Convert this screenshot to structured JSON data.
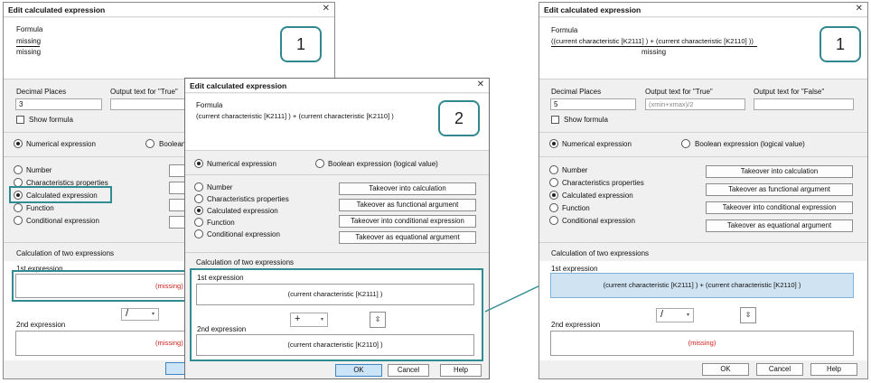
{
  "d1": {
    "title": "Edit calculated expression",
    "close": "✕",
    "callout": "1",
    "formula_label": "Formula",
    "formula_top": "missing",
    "formula_bottom": "missing",
    "decimal_label": "Decimal Places",
    "decimal_value": "3",
    "output_true_label": "Output text for \"True\"",
    "show_formula": "Show formula",
    "numerical": "Numerical expression",
    "boolean": "Boolean",
    "types": [
      "Number",
      "Characteristics properties",
      "Calculated expression",
      "Function",
      "Conditional expression"
    ],
    "calc_label": "Calculation of two expressions",
    "first_label": "1st expression",
    "first_value": "(missing)",
    "operator": "/",
    "second_label": "2nd expression",
    "second_value": "(missing)"
  },
  "d2": {
    "title": "Edit calculated expression",
    "close": "✕",
    "callout": "2",
    "formula_label": "Formula",
    "formula": "(current characteristic [K2111] ) + (current characteristic [K2110] )",
    "numerical": "Numerical expression",
    "boolean": "Boolean expression (logical value)",
    "types": [
      "Number",
      "Characteristics properties",
      "Calculated expression",
      "Function",
      "Conditional expression"
    ],
    "takeover": [
      "Takeover into calculation",
      "Takeover as functional argument",
      "Takeover into conditional expression",
      "Takeover as equational argument"
    ],
    "calc_label": "Calculation of two expressions",
    "first_label": "1st expression",
    "first_value": "(current characteristic [K2111] )",
    "operator": "+",
    "swap": "⇳",
    "second_label": "2nd expression",
    "second_value": "(current characteristic [K2110] )",
    "ok": "OK",
    "cancel": "Cancel",
    "help": "Help"
  },
  "d3": {
    "title": "Edit calculated expression",
    "close": "✕",
    "callout": "1",
    "formula_label": "Formula",
    "formula_top": "((current characteristic [K2111] ) + (current characteristic [K2110] ))",
    "formula_bottom": "missing",
    "decimal_label": "Decimal Places",
    "decimal_value": "5",
    "output_true_label": "Output text for \"True\"",
    "output_true_placeholder": "(xmin+xmax)/2",
    "output_false_label": "Output text for \"False\"",
    "show_formula": "Show formula",
    "numerical": "Numerical expression",
    "boolean": "Boolean expression (logical value)",
    "types": [
      "Number",
      "Characteristics properties",
      "Calculated expression",
      "Function",
      "Conditional expression"
    ],
    "takeover": [
      "Takeover into calculation",
      "Takeover as functional argument",
      "Takeover into conditional expression",
      "Takeover as equational argument"
    ],
    "calc_label": "Calculation of two expressions",
    "first_label": "1st expression",
    "first_value": "(current characteristic [K2111] ) + (current characteristic [K2110] )",
    "operator": "/",
    "swap": "⇳",
    "second_label": "2nd expression",
    "second_value": "(missing)",
    "ok": "OK",
    "cancel": "Cancel",
    "help": "Help"
  },
  "colors": {
    "highlight": "#2e8c92",
    "selected_expression": "#cfe3f3",
    "missing": "#d02020"
  }
}
